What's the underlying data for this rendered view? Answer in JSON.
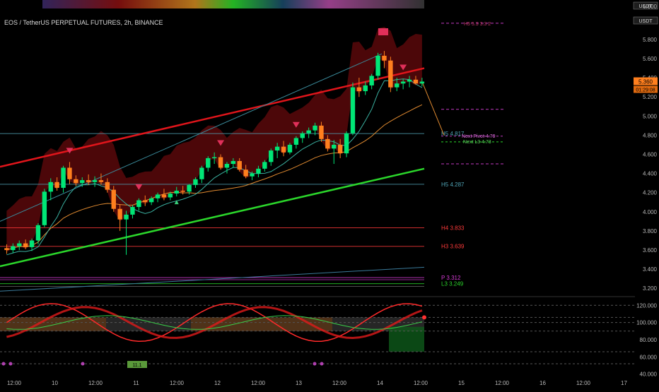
{
  "header": {
    "symbol_title": "EOS / TetherUS PERPETUAL FUTURES, 2h, BINANCE",
    "currency_label": "USDT"
  },
  "colors": {
    "background": "#000000",
    "bull": "#00e676",
    "bear": "#ff7f1e",
    "red_channel": "#e0151b",
    "green_channel": "#2bd62b",
    "cloud": "#8b0d10",
    "pivot_magenta": "#d63bd6",
    "pivot_teal": "#4fa3b5",
    "pivot_red": "#ff3a3a"
  },
  "chart_data": [
    {
      "type": "candlestick",
      "symbol": "EOS / TetherUS PERPETUAL FUTURES",
      "interval": "2h",
      "exchange": "BINANCE",
      "ylim": [
        3.15,
        6.05
      ],
      "y_ticks": [
        "6.000",
        "5.800",
        "5.600",
        "5.400",
        "5.200",
        "5.000",
        "4.800",
        "4.600",
        "4.400",
        "4.200",
        "4.000",
        "3.800",
        "3.600",
        "3.400",
        "3.200"
      ],
      "top_axis_label": "6.000",
      "last_price": "5.360",
      "countdown": "01:29:08",
      "x_ticks": [
        "12:00",
        "10",
        "12:00",
        "11",
        "12:00",
        "12",
        "12:00",
        "13",
        "12:00",
        "14",
        "12:00",
        "15",
        "12:00",
        "16",
        "12:00",
        "17"
      ],
      "ohlc": [
        [
          3.62,
          3.66,
          3.56,
          3.6
        ],
        [
          3.6,
          3.67,
          3.57,
          3.64
        ],
        [
          3.64,
          3.7,
          3.6,
          3.67
        ],
        [
          3.67,
          3.71,
          3.61,
          3.63
        ],
        [
          3.63,
          3.72,
          3.59,
          3.7
        ],
        [
          3.7,
          3.88,
          3.66,
          3.86
        ],
        [
          3.86,
          4.24,
          3.84,
          4.21
        ],
        [
          4.21,
          4.35,
          4.12,
          4.31
        ],
        [
          4.31,
          4.36,
          4.22,
          4.25
        ],
        [
          4.25,
          4.48,
          4.2,
          4.46
        ],
        [
          4.46,
          4.52,
          4.29,
          4.34
        ],
        [
          4.34,
          4.38,
          4.27,
          4.3
        ],
        [
          4.3,
          4.36,
          4.26,
          4.33
        ],
        [
          4.33,
          4.39,
          4.28,
          4.31
        ],
        [
          4.31,
          4.37,
          4.26,
          4.33
        ],
        [
          4.33,
          4.4,
          4.28,
          4.31
        ],
        [
          4.31,
          4.35,
          4.2,
          4.23
        ],
        [
          4.23,
          4.27,
          4.0,
          4.03
        ],
        [
          4.03,
          4.08,
          3.8,
          3.92
        ],
        [
          3.92,
          4.01,
          3.55,
          3.97
        ],
        [
          3.97,
          4.07,
          3.93,
          4.05
        ],
        [
          4.05,
          4.14,
          4.01,
          4.12
        ],
        [
          4.12,
          4.17,
          4.06,
          4.1
        ],
        [
          4.1,
          4.16,
          4.07,
          4.14
        ],
        [
          4.14,
          4.2,
          4.1,
          4.18
        ],
        [
          4.18,
          4.24,
          4.12,
          4.15
        ],
        [
          4.15,
          4.21,
          4.12,
          4.19
        ],
        [
          4.19,
          4.26,
          4.16,
          4.22
        ],
        [
          4.22,
          4.27,
          4.18,
          4.21
        ],
        [
          4.21,
          4.29,
          4.18,
          4.28
        ],
        [
          4.28,
          4.36,
          4.25,
          4.34
        ],
        [
          4.34,
          4.48,
          4.3,
          4.46
        ],
        [
          4.46,
          4.58,
          4.42,
          4.56
        ],
        [
          4.56,
          4.62,
          4.5,
          4.57
        ],
        [
          4.57,
          4.6,
          4.44,
          4.46
        ],
        [
          4.46,
          4.52,
          4.4,
          4.5
        ],
        [
          4.5,
          4.56,
          4.46,
          4.53
        ],
        [
          4.53,
          4.56,
          4.42,
          4.44
        ],
        [
          4.44,
          4.49,
          4.35,
          4.37
        ],
        [
          4.37,
          4.42,
          4.33,
          4.4
        ],
        [
          4.4,
          4.48,
          4.36,
          4.45
        ],
        [
          4.45,
          4.54,
          4.42,
          4.52
        ],
        [
          4.52,
          4.66,
          4.48,
          4.64
        ],
        [
          4.64,
          4.72,
          4.56,
          4.68
        ],
        [
          4.68,
          4.74,
          4.58,
          4.62
        ],
        [
          4.62,
          4.72,
          4.6,
          4.7
        ],
        [
          4.7,
          4.79,
          4.66,
          4.77
        ],
        [
          4.77,
          4.84,
          4.72,
          4.82
        ],
        [
          4.82,
          4.88,
          4.77,
          4.85
        ],
        [
          4.85,
          4.93,
          4.8,
          4.9
        ],
        [
          4.9,
          4.94,
          4.73,
          4.76
        ],
        [
          4.76,
          4.8,
          4.63,
          4.66
        ],
        [
          4.66,
          4.75,
          4.5,
          4.7
        ],
        [
          4.7,
          4.76,
          4.56,
          4.61
        ],
        [
          4.61,
          4.84,
          4.57,
          4.82
        ],
        [
          4.82,
          5.35,
          4.8,
          5.3
        ],
        [
          5.3,
          5.4,
          5.2,
          5.26
        ],
        [
          5.26,
          5.36,
          5.22,
          5.32
        ],
        [
          5.32,
          5.44,
          5.28,
          5.42
        ],
        [
          5.42,
          5.66,
          5.38,
          5.63
        ],
        [
          5.63,
          5.68,
          5.5,
          5.58
        ],
        [
          5.58,
          5.62,
          5.25,
          5.3
        ],
        [
          5.3,
          5.4,
          5.26,
          5.34
        ],
        [
          5.34,
          5.39,
          5.28,
          5.36
        ],
        [
          5.36,
          5.42,
          5.3,
          5.38
        ],
        [
          5.38,
          5.42,
          5.33,
          5.34
        ],
        [
          5.34,
          5.4,
          5.31,
          5.36
        ]
      ],
      "pivot_levels": [
        {
          "label": "H5 4.817",
          "value": 4.817,
          "color": "#4fa3b5"
        },
        {
          "label": "H5 4.287",
          "value": 4.287,
          "color": "#4fa3b5"
        },
        {
          "label": "H4 3.833",
          "value": 3.833,
          "color": "#ff3a3a"
        },
        {
          "label": "H3 3.639",
          "value": 3.639,
          "color": "#ff3a3a"
        },
        {
          "label": "P 3.312",
          "value": 3.312,
          "color": "#d63bd6"
        },
        {
          "label": "L3 3.249",
          "value": 3.249,
          "color": "#2bd62b"
        }
      ],
      "next_pivot": {
        "label": "Next Pivot 4.79",
        "value": 4.79
      },
      "next_pivot_sub": {
        "label": "Next L3 4.73",
        "value": 4.73
      },
      "top_right_label": "H5 5.3 3.3 2",
      "dashed_forecast_levels": [
        5.07,
        4.5,
        5.97
      ],
      "channel_upper": {
        "start": [
          0,
          4.47
        ],
        "end": [
          67,
          5.5
        ]
      },
      "channel_lower": {
        "start": [
          0,
          3.43
        ],
        "end": [
          67,
          4.45
        ]
      },
      "sell_markers": [
        10.5,
        21.5,
        34.5,
        46.5,
        63.5
      ],
      "buy_markers": [
        27
      ]
    },
    {
      "type": "oscillator",
      "ylim": [
        38,
        126
      ],
      "y_ticks": [
        "120.000",
        "100.000",
        "80.000",
        "60.000",
        "40.000"
      ],
      "badge_label": "11.1",
      "levels": [
        120,
        106,
        100,
        90,
        66,
        52
      ]
    }
  ]
}
